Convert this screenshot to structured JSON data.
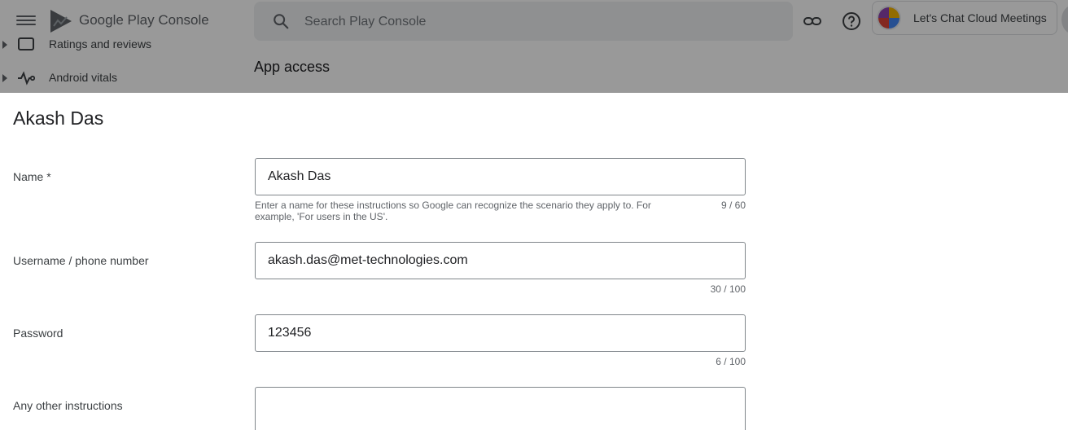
{
  "header": {
    "product_name": "Google Play Console",
    "search_placeholder": "Search Play Console",
    "account_name": "Let's Chat Cloud Meetings"
  },
  "sidebar": {
    "items": [
      {
        "label": "Ratings and reviews",
        "icon": "ratings-icon"
      },
      {
        "label": "Android vitals",
        "icon": "vitals-icon"
      }
    ]
  },
  "main": {
    "page_title": "App access"
  },
  "dialog": {
    "title": "Akash Das",
    "fields": {
      "name": {
        "label": "Name  *",
        "value": "Akash Das",
        "hint": "Enter a name for these instructions so Google can recognize the scenario they apply to. For example, 'For users in the US'.",
        "counter": "9 / 60"
      },
      "username": {
        "label": "Username / phone number",
        "value": "akash.das@met-technologies.com",
        "counter": "30 / 100"
      },
      "password": {
        "label": "Password",
        "value": "123456",
        "counter": "6 / 100"
      },
      "other": {
        "label": "Any other instructions",
        "value": ""
      }
    }
  },
  "colors": {
    "scrim": "#000000",
    "input_border": "#80868b",
    "muted_text": "#5f6368"
  }
}
